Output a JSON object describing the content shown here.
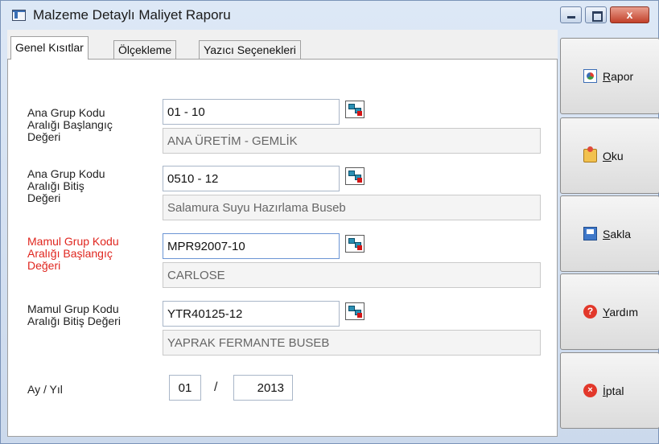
{
  "window": {
    "title": "Malzeme Detaylı Maliyet Raporu",
    "close_glyph": "x"
  },
  "tabs": [
    {
      "label": "Genel Kısıtlar",
      "active": true
    },
    {
      "label": "Ölçekleme",
      "active": false
    },
    {
      "label": "Yazıcı Seçenekleri",
      "active": false
    }
  ],
  "form": {
    "ana_grup_baslangic": {
      "label_lines": [
        "Ana Grup Kodu",
        "Aralığı Başlangıç",
        "Değeri"
      ],
      "code": "01 - 10",
      "description": "ANA ÜRETİM - GEMLİK"
    },
    "ana_grup_bitis": {
      "label_lines": [
        "Ana Grup Kodu",
        "Aralığı Bitiş",
        "Değeri"
      ],
      "code": "0510 - 12",
      "description": "Salamura Suyu Hazırlama Buseb"
    },
    "mamul_grup_baslangic": {
      "label_lines": [
        "Mamul Grup Kodu",
        "Aralığı Başlangıç",
        "Değeri"
      ],
      "code": "MPR92007-10",
      "description": "CARLOSE",
      "label_color": "#e0261f"
    },
    "mamul_grup_bitis": {
      "label_lines": [
        "Mamul Grup Kodu",
        "Aralığı Bitiş Değeri"
      ],
      "code": "YTR40125-12",
      "description": "YAPRAK FERMANTE BUSEB"
    },
    "period": {
      "label": "Ay / Yıl",
      "month": "01",
      "separator": "/",
      "year": "2013"
    }
  },
  "buttons": {
    "rapor": {
      "first": "R",
      "rest": "apor",
      "icon": "report-icon"
    },
    "oku": {
      "first": "O",
      "rest": "ku",
      "icon": "open-folder-icon"
    },
    "sakla": {
      "first": "S",
      "rest": "akla",
      "icon": "save-icon"
    },
    "yardim": {
      "first": "Y",
      "rest": "ardım",
      "icon": "help-icon",
      "glyph": "?"
    },
    "iptal": {
      "first": "İ",
      "rest": "ptal",
      "icon": "cancel-icon",
      "glyph": "×"
    }
  }
}
